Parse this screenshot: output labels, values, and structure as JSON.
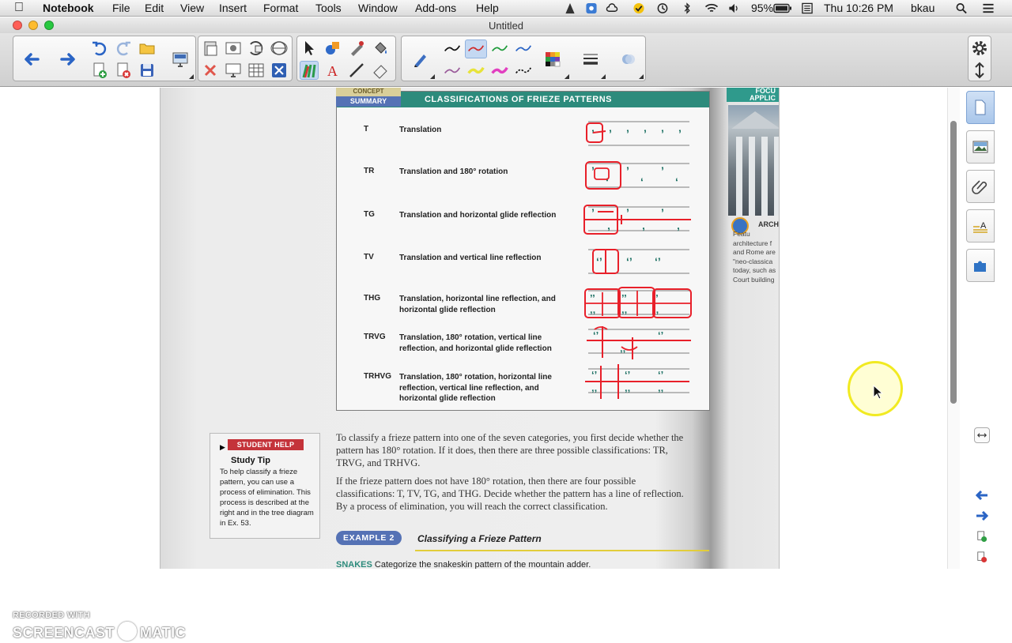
{
  "menubar": {
    "app_name": "Notebook",
    "items": [
      "File",
      "Edit",
      "View",
      "Insert",
      "Format",
      "Tools",
      "Window",
      "Add-ons",
      "Help"
    ],
    "battery": "95%",
    "clock": "Thu 10:26 PM",
    "user": "bkau"
  },
  "window": {
    "title": "Untitled"
  },
  "document": {
    "concept_tag_top": "CONCEPT",
    "concept_tag_bottom": "SUMMARY",
    "summary_title": "CLASSIFICATIONS OF FRIEZE PATTERNS",
    "rows": [
      {
        "code": "T",
        "desc": "Translation"
      },
      {
        "code": "TR",
        "desc": "Translation and 180° rotation"
      },
      {
        "code": "TG",
        "desc": "Translation and horizontal glide reflection"
      },
      {
        "code": "TV",
        "desc": "Translation and vertical line reflection"
      },
      {
        "code": "THG",
        "desc": "Translation, horizontal line reflection, and horizontal glide reflection"
      },
      {
        "code": "TRVG",
        "desc": "Translation, 180° rotation, vertical line reflection, and horizontal glide reflection"
      },
      {
        "code": "TRHVG",
        "desc": "Translation, 180° rotation, horizontal line reflection, vertical line reflection, and horizontal glide reflection"
      }
    ],
    "para1": "To classify a frieze pattern into one of the seven categories, you first decide whether the pattern has 180° rotation. If it does, then there are three possible classifications: TR, TRVG, and TRHVG.",
    "para2": "If the frieze pattern does not have 180° rotation, then there are four possible classifications: T, TV, TG, and THG. Decide whether the pattern has a line of reflection. By a process of elimination, you will reach the correct classification.",
    "help_tag": "STUDENT HELP",
    "help_title": "Study Tip",
    "help_body": "To help classify a frieze pattern, you can use a process of elimination. This process is described at the right and in the tree diagram in Ex. 53.",
    "example_label": "EXAMPLE 2",
    "example_title": "Classifying a Frieze Pattern",
    "snakes_label": "SNAKES",
    "snakes_text": "Categorize the snakeskin pattern of the mountain adder.",
    "focus_head": "FOCU APPLIC",
    "focus_title": "ARCH",
    "focus_text": "Featu architecture f and Rome are \"neo-classica today, such as Court building"
  },
  "watermark": {
    "top": "RECORDED WITH",
    "left": "SCREENCAST",
    "right": "MATIC"
  },
  "colors": {
    "ink": "#e8202a",
    "header": "#2d8b7c",
    "highlight": "#f1ea21"
  }
}
